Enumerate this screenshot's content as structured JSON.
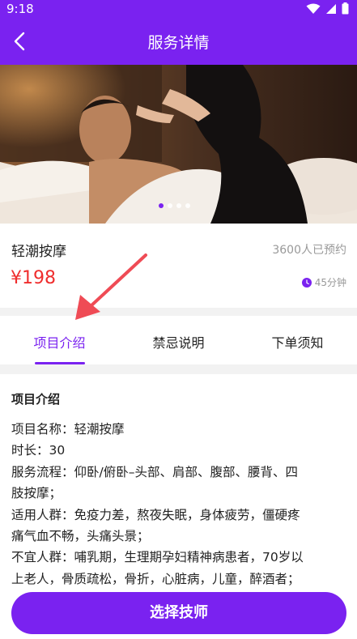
{
  "status_bar": {
    "time": "9:18"
  },
  "header": {
    "title": "服务详情"
  },
  "hero": {
    "slide_count": 4,
    "active_slide": 1
  },
  "service": {
    "name": "轻潮按摩",
    "booked": "3600人已预约",
    "price": "¥198",
    "duration": "45分钟"
  },
  "tabs": [
    {
      "label": "项目介绍",
      "active": true
    },
    {
      "label": "禁忌说明",
      "active": false
    },
    {
      "label": "下单须知",
      "active": false
    }
  ],
  "content": {
    "section_title": "项目介绍",
    "lines": [
      "项目名称：轻潮按摩",
      "时长：30",
      "服务流程：仰卧/俯卧–头部、肩部、腹部、腰背、四",
      "肢按摩；",
      "适用人群：免疫力差，熬夜失眠，身体疲劳，僵硬疼",
      "痛气血不畅，头痛头景；",
      "不宜人群：哺乳期，生理期孕妇精神病患者，70岁以",
      "上老人，骨质疏松，骨折，心脏病，儿童，醉酒者；"
    ]
  },
  "cta": {
    "label": "选择技师"
  },
  "colors": {
    "accent": "#7a22f0",
    "price": "#ef2d2d",
    "annotation_arrow": "#ef4b55"
  }
}
